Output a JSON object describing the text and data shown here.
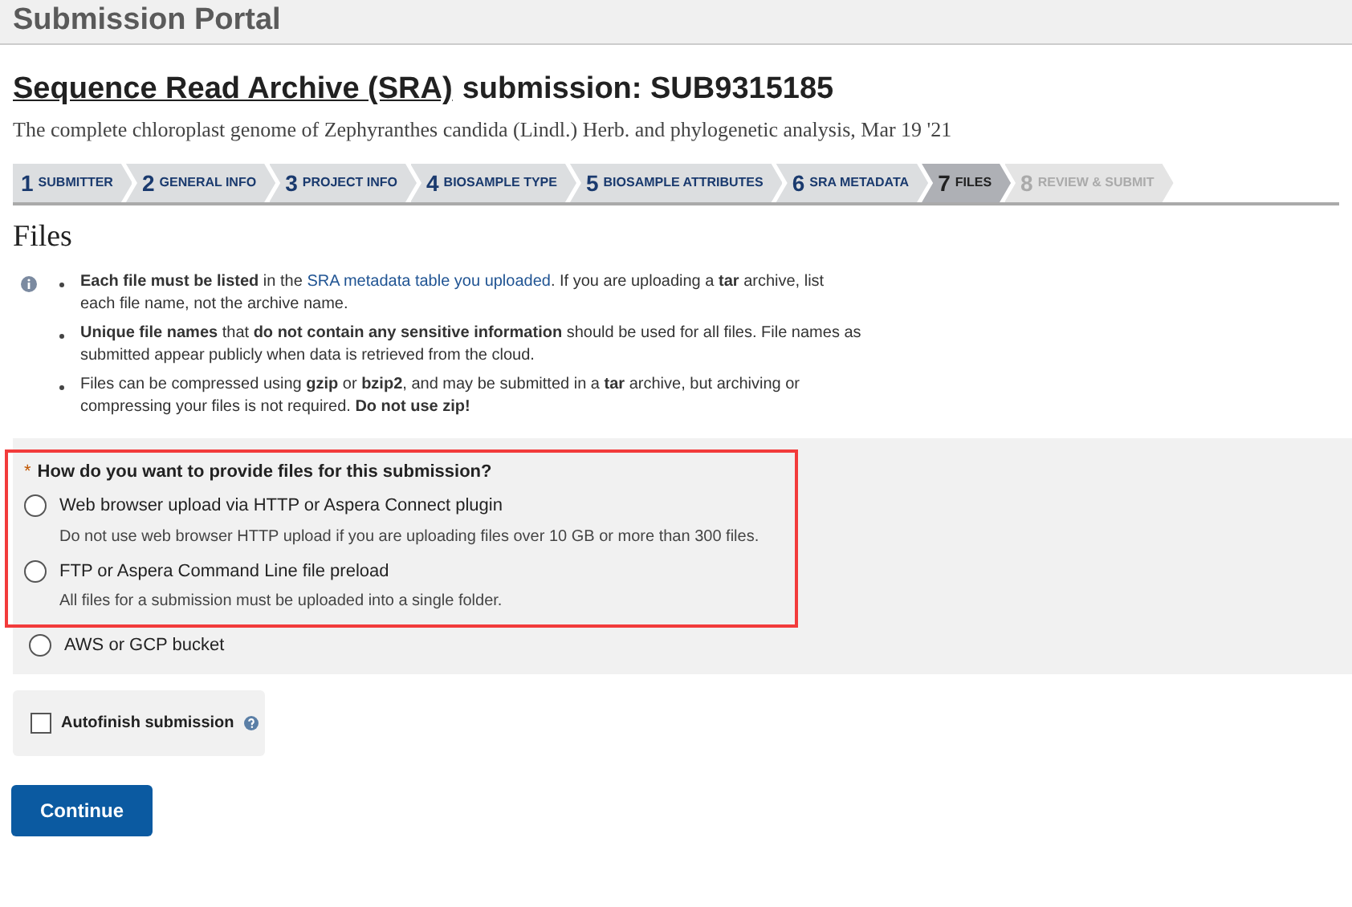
{
  "header": {
    "title": "Submission Portal"
  },
  "submission": {
    "title_link": "Sequence Read Archive (SRA)",
    "title_rest": "submission: SUB9315185",
    "subtitle": "The complete chloroplast genome of Zephyranthes candida (Lindl.) Herb. and phylogenetic analysis, Mar 19 '21"
  },
  "steps": [
    {
      "number": "1",
      "label": "SUBMITTER",
      "selected": false,
      "disabled": false
    },
    {
      "number": "2",
      "label": "GENERAL INFO",
      "selected": false,
      "disabled": false
    },
    {
      "number": "3",
      "label": "PROJECT INFO",
      "selected": false,
      "disabled": false
    },
    {
      "number": "4",
      "label": "BIOSAMPLE TYPE",
      "selected": false,
      "disabled": false
    },
    {
      "number": "5",
      "label": "BIOSAMPLE ATTRIBUTES",
      "selected": false,
      "disabled": false
    },
    {
      "number": "6",
      "label": "SRA METADATA",
      "selected": false,
      "disabled": false
    },
    {
      "number": "7",
      "label": "FILES",
      "selected": true,
      "disabled": false
    },
    {
      "number": "8",
      "label": "REVIEW & SUBMIT",
      "selected": false,
      "disabled": true
    }
  ],
  "section_title": "Files",
  "notes": [
    [
      {
        "kind": "text",
        "text": "**Each file must be listed** in the"
      },
      {
        "kind": "link",
        "text": "SRA metadata table you uploaded"
      },
      {
        "kind": "text",
        "text": ". If you are uploading a **tar** archive, list each file name, not the archive name."
      }
    ],
    [
      {
        "kind": "text",
        "text": "**Unique file names** that **do not contain any sensitive information** should be used for all files. File names as submitted appear publicly when data is retrieved from the cloud."
      }
    ],
    [
      {
        "kind": "text",
        "text": "Files can be compressed using **gzip** or **bzip2**, and may be submitted in a **tar** archive, but archiving or compressing your files is not required. **Do not use zip!**"
      }
    ]
  ],
  "question": {
    "required_mark": "*",
    "label": "How do you want to provide files for this submission?",
    "highlighted": true,
    "options": [
      {
        "label": "Web browser upload via HTTP or Aspera Connect plugin",
        "description": "Do not use web browser HTTP upload if you are uploading files over 10 GB or more than 300 files.",
        "selected": false,
        "highlighted": true
      },
      {
        "label": "FTP or Aspera Command Line file preload",
        "description": "All files for a submission must be uploaded into a single folder.",
        "selected": false,
        "highlighted": true
      },
      {
        "label": "AWS or GCP bucket",
        "selected": false,
        "highlighted": false
      }
    ]
  },
  "autofinish": {
    "label": "Autofinish submission",
    "checked": false
  },
  "continue_button": "Continue"
}
